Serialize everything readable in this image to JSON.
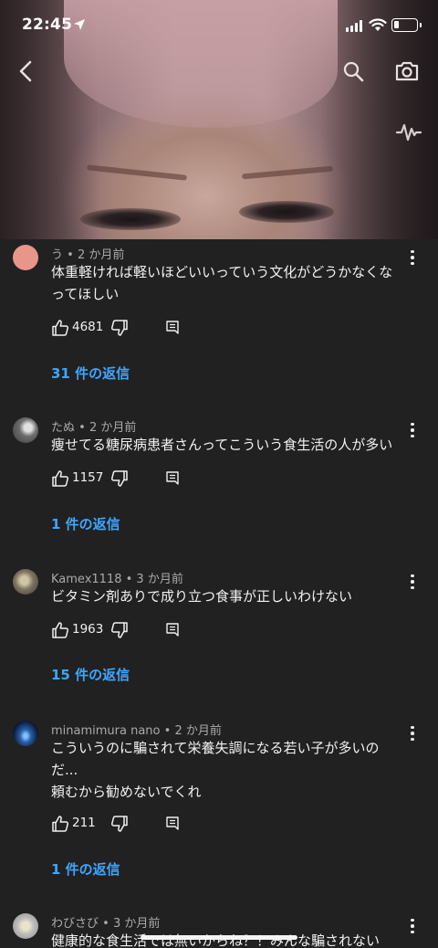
{
  "status_bar": {
    "time": "22:45"
  },
  "comments": [
    {
      "author": "う",
      "sep": " • ",
      "age": "2 か月前",
      "lines": [
        "体重軽ければ軽いほどいいっていう文化がどうかなくな",
        "ってほしい"
      ],
      "likes": "4681",
      "replies": "31 件の返信",
      "avatar_color": "#e8968a"
    },
    {
      "author": "たぬ",
      "sep": " • ",
      "age": "2 か月前",
      "lines": [
        "痩せてる糖尿病患者さんってこういう食生活の人が多い"
      ],
      "likes": "1157",
      "replies": "1 件の返信",
      "avatar_color": "#6d6d6d"
    },
    {
      "author": "Kamex1118",
      "sep": " • ",
      "age": "3 か月前",
      "lines": [
        "ビタミン剤ありで成り立つ食事が正しいわけない"
      ],
      "likes": "1963",
      "replies": "15 件の返信",
      "avatar_color": "#8a7f6c"
    },
    {
      "author": "minamimura nano",
      "sep": " • ",
      "age": "2 か月前",
      "lines": [
        "こういうのに騙されて栄養失調になる若い子が多いの",
        "だ...",
        "頼むから勧めないでくれ"
      ],
      "likes": "211",
      "replies": "1 件の返信",
      "avatar_color": "#1c3b6e"
    },
    {
      "author": "わびさび",
      "sep": " • ",
      "age": "3 か月前",
      "lines": [
        "健康的な食生活では無いからね？！みんな騙されない"
      ],
      "likes": "",
      "replies": "",
      "avatar_color": "#c9c9c9"
    }
  ]
}
